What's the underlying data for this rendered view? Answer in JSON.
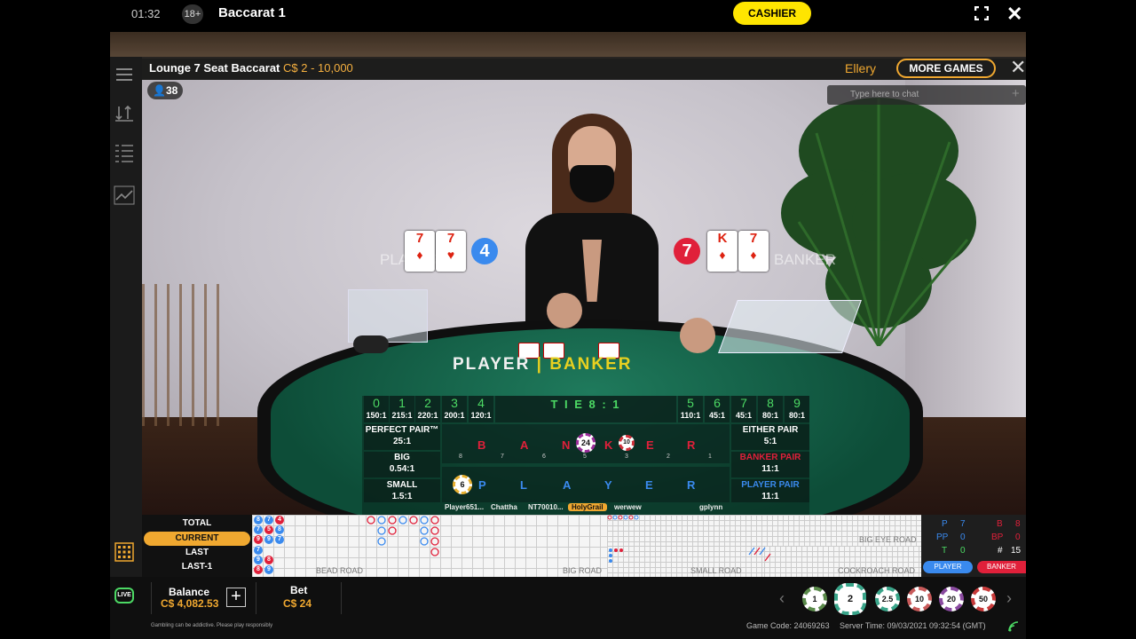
{
  "topbar": {
    "time": "01:32",
    "age_badge": "18+",
    "title": "Baccarat 1",
    "cashier": "CASHIER"
  },
  "header": {
    "table_name": "Lounge 7 Seat Baccarat",
    "limits": "C$ 2 - 10,000",
    "username": "Ellery",
    "more_games": "MORE GAMES",
    "chat_placeholder": "Type here to chat",
    "chat_plus": "+",
    "player_count": "38"
  },
  "result": {
    "player_label": "PLAYER",
    "banker_label": "BANKER",
    "player_score": "4",
    "banker_score": "7",
    "player_cards": [
      {
        "rank": "7",
        "suit": "♦"
      },
      {
        "rank": "7",
        "suit": "♥"
      }
    ],
    "banker_cards": [
      {
        "rank": "K",
        "suit": "♦"
      },
      {
        "rank": "7",
        "suit": "♦"
      }
    ]
  },
  "table_print": {
    "player": "PLAYER",
    "separator": "|",
    "banker": "BANKER"
  },
  "payouts": [
    {
      "n": "0",
      "o": "150:1"
    },
    {
      "n": "1",
      "o": "215:1"
    },
    {
      "n": "2",
      "o": "220:1"
    },
    {
      "n": "3",
      "o": "200:1"
    },
    {
      "n": "4",
      "o": "120:1"
    },
    {
      "n": "5",
      "o": "110:1"
    },
    {
      "n": "6",
      "o": "45:1"
    },
    {
      "n": "7",
      "o": "45:1"
    },
    {
      "n": "8",
      "o": "80:1"
    },
    {
      "n": "9",
      "o": "80:1"
    }
  ],
  "tie": {
    "label": "T I E   8 : 1"
  },
  "side_bets": {
    "perfect_pair": {
      "name": "PERFECT PAIR™",
      "odds": "25:1"
    },
    "big": {
      "name": "BIG",
      "odds": "0.54:1"
    },
    "small": {
      "name": "SMALL",
      "odds": "1.5:1"
    },
    "either_pair": {
      "name": "EITHER PAIR",
      "odds": "5:1"
    },
    "banker_pair": {
      "name": "BANKER PAIR",
      "odds": "11:1"
    },
    "player_pair": {
      "name": "PLAYER PAIR",
      "odds": "11:1"
    }
  },
  "main_bets": {
    "banker_letters": [
      "B",
      "A",
      "N",
      "K",
      "E",
      "R"
    ],
    "player_letters": [
      "P",
      "L",
      "A",
      "Y",
      "E",
      "R"
    ],
    "seat_numbers": [
      "8",
      "7",
      "6",
      "5",
      "3",
      "2",
      "1"
    ]
  },
  "table_chips": [
    {
      "value": "24",
      "color": "#9b2d9b"
    },
    {
      "value": "10",
      "color": "#d0303a"
    },
    {
      "value": "6",
      "color": "#e8b030"
    }
  ],
  "seat_names": [
    "Player651...",
    "Chattha",
    "NT70010...",
    "HolyGrail",
    "werwew",
    "gplynn"
  ],
  "history_tabs": {
    "total": "TOTAL",
    "current": "CURRENT",
    "last": "LAST",
    "last1": "LAST-1"
  },
  "bead_road": [
    [
      "8",
      "7",
      "4"
    ],
    [
      "7",
      "5",
      "8"
    ],
    [
      "9",
      "9",
      "7"
    ],
    [
      "7"
    ],
    [
      "9",
      "8"
    ],
    [
      "8",
      "9"
    ]
  ],
  "roads": {
    "bead": "BEAD ROAD",
    "big": "BIG ROAD",
    "big_eye": "BIG EYE ROAD",
    "small": "SMALL ROAD",
    "cockroach": "COCKROACH ROAD"
  },
  "stats": {
    "p_label": "P",
    "p": "7",
    "pp_label": "PP",
    "pp": "0",
    "t_label": "T",
    "t": "0",
    "b_label": "B",
    "b": "8",
    "bp_label": "BP",
    "bp": "0",
    "hash_label": "#",
    "hash": "15",
    "player_btn": "PLAYER",
    "banker_btn": "BANKER"
  },
  "bottom": {
    "balance_label": "Balance",
    "balance_value": "C$ 4,082.53",
    "add": "+",
    "bet_label": "Bet",
    "bet_value": "C$ 24",
    "live": "LIVE",
    "disclaimer": "Gambling can be addictive. Please play responsibly",
    "game_code": "Game Code: 24069263",
    "server_time": "Server Time: 09/03/2021 09:32:54 (GMT)"
  },
  "chips": [
    {
      "value": "1",
      "color": "#5a8a4a"
    },
    {
      "value": "2",
      "color": "#3aa58a"
    },
    {
      "value": "2.5",
      "color": "#3aa58a"
    },
    {
      "value": "10",
      "color": "#c85a5a"
    },
    {
      "value": "20",
      "color": "#8a4aa0"
    },
    {
      "value": "50",
      "color": "#c83a3a"
    }
  ],
  "colors": {
    "accent": "#f0a830",
    "cashier": "#ffe500",
    "player": "#3a8aee",
    "banker": "#e0203a",
    "felt": "#0d4d38",
    "odds_green": "#4cd964"
  }
}
